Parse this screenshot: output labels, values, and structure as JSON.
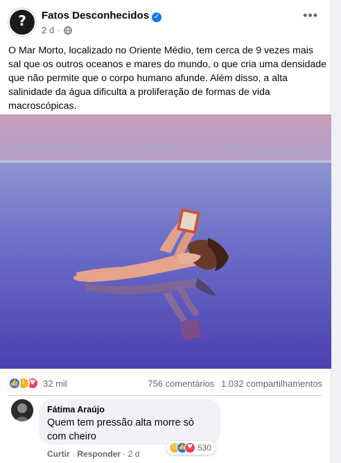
{
  "post": {
    "page_name": "Fatos Desconhecidos",
    "time": "2 d",
    "meta_separator": "·",
    "text": "O Mar Morto, localizado no Oriente Médio, tem cerca de 9 vezes mais sal que os outros oceanos e mares do mundo, o que cria uma densidade que não permite que o corpo humano afunde. Além disso, a alta salinidade da água dificulta a proliferação de formas de vida macroscópicas."
  },
  "photo": {
    "description_icon": "photo-woman-floating-reading"
  },
  "counts": {
    "reactions": "32 mil",
    "comments": "756 comentários",
    "shares": "1.032 compartilhamentos"
  },
  "comment": {
    "author": "Fátima Araújo",
    "text": "Quem tem pressão alta morre só com cheiro",
    "reaction_count": "530",
    "like_label": "Curtir",
    "reply_label": "Responder",
    "time": "2 d",
    "separator": "·"
  },
  "colors": {
    "brand_blue": "#1877f2",
    "secondary_text": "#65676b"
  }
}
